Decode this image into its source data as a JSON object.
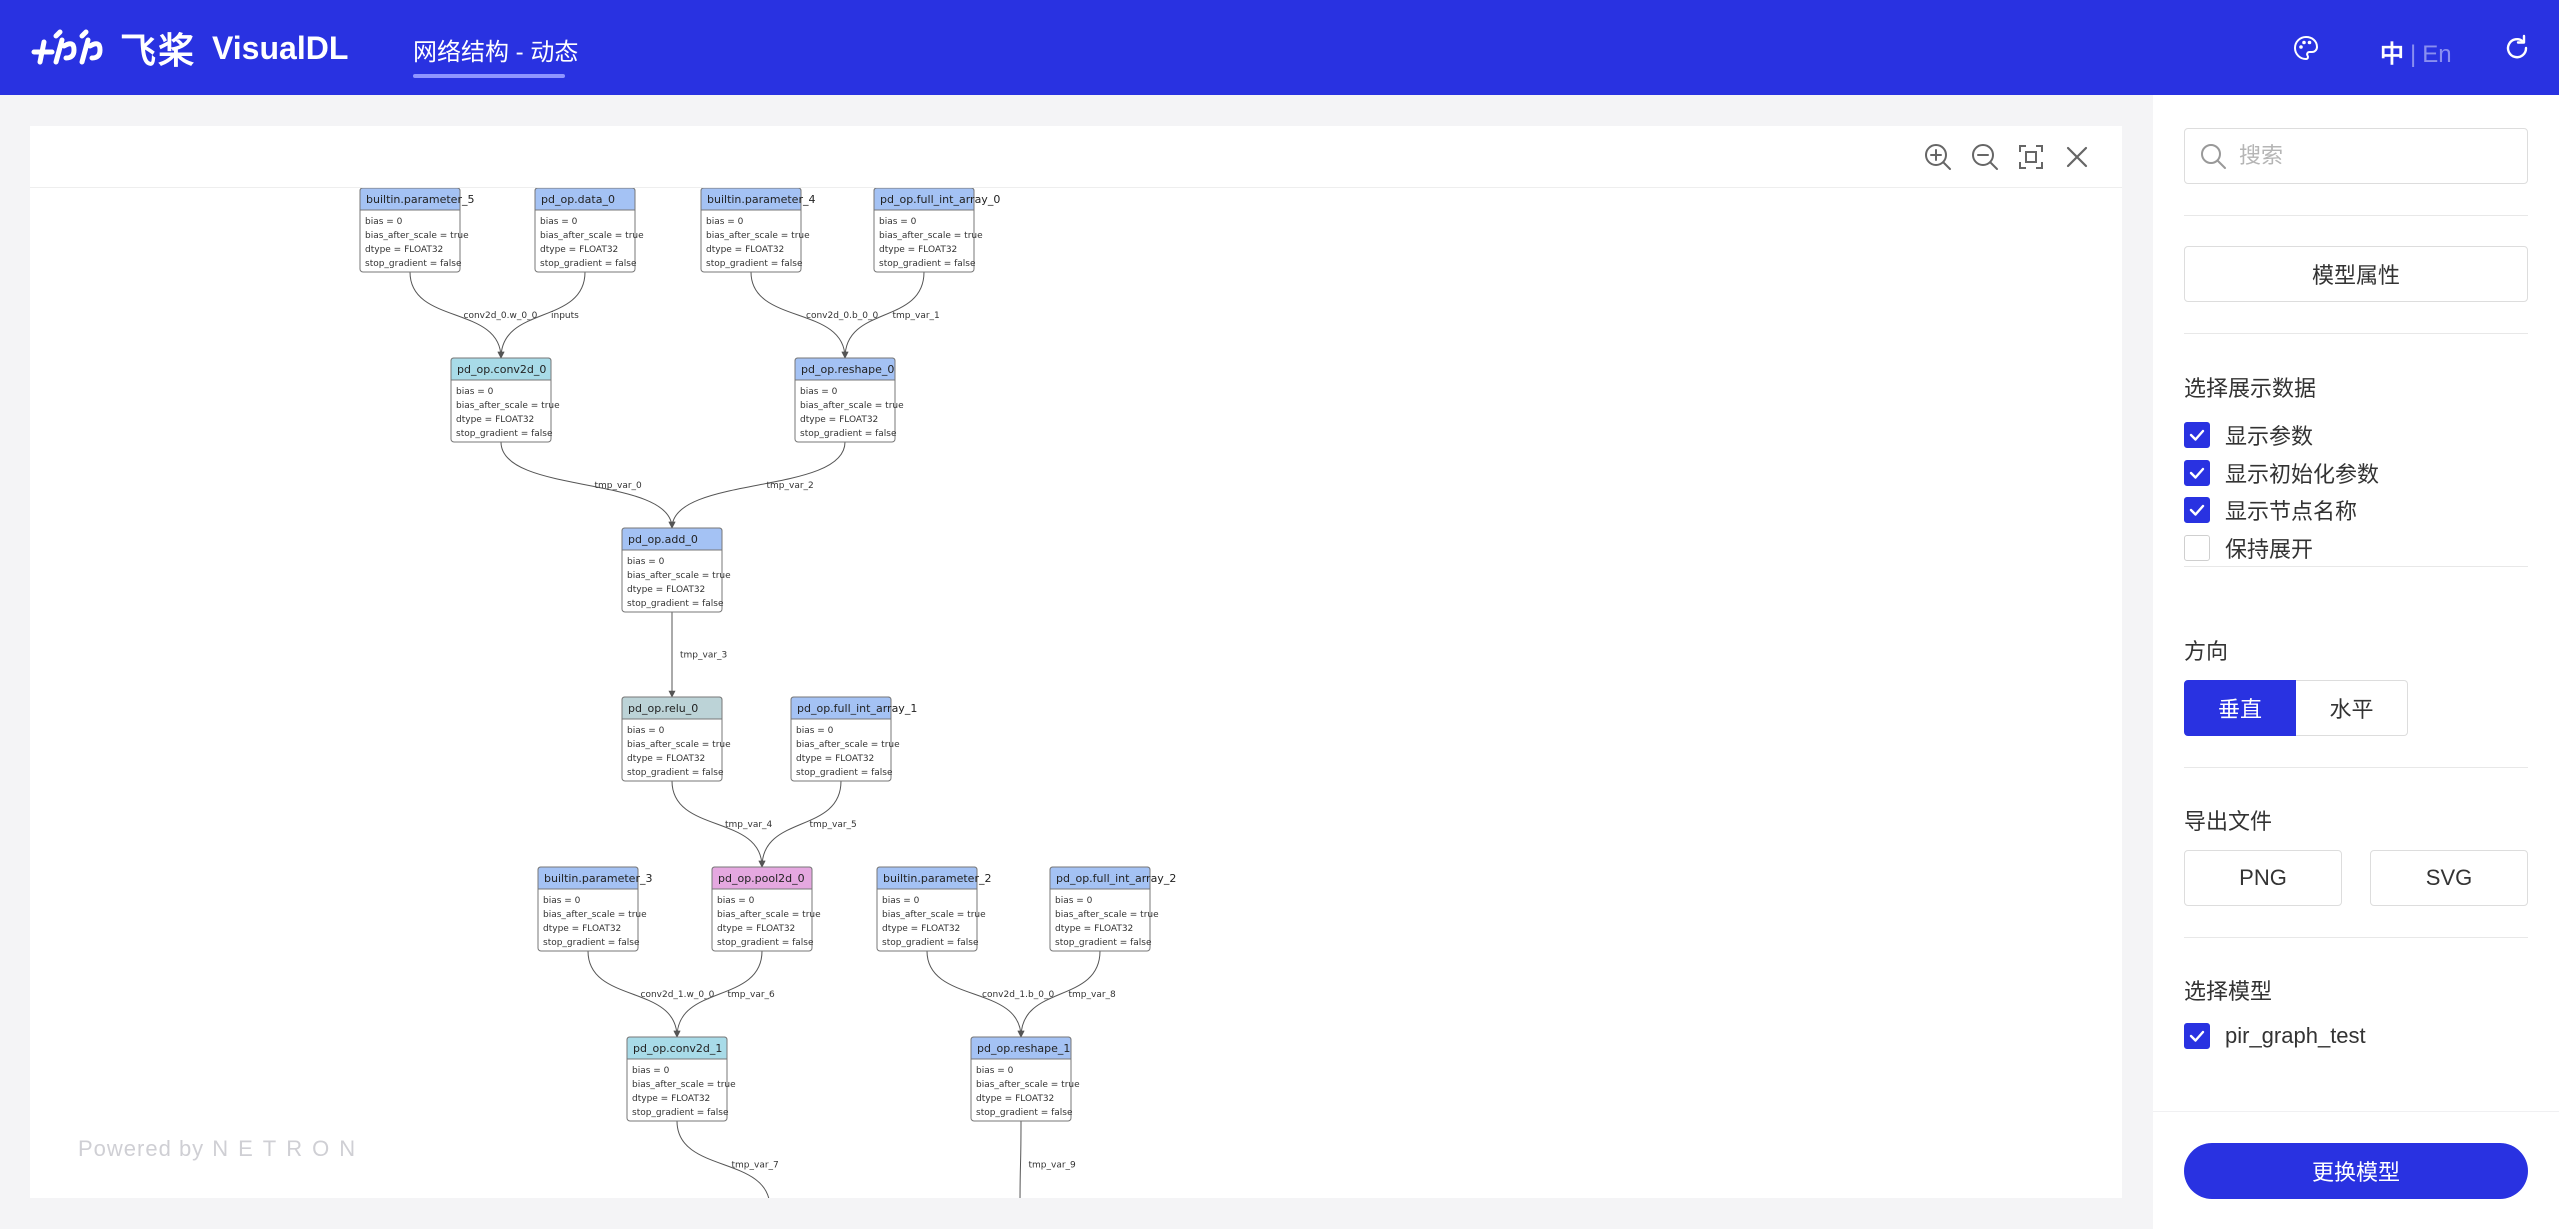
{
  "header": {
    "logo_cn": "飞桨",
    "logo_en": "VisualDL",
    "nav_tab": "网络结构 - 动态",
    "lang_current": "中",
    "lang_separator": "|",
    "lang_other": "En",
    "icons": [
      "palette-icon",
      "refresh-icon"
    ]
  },
  "graph": {
    "toolbar_icons": [
      "zoom-in-icon",
      "zoom-out-icon",
      "fit-screen-icon",
      "close-icon"
    ],
    "powered_by": "Powered by",
    "netron": "NETRON",
    "attr_lines": [
      "bias = 0",
      "bias_after_scale = true",
      "dtype = FLOAT32",
      "stop_gradient = false"
    ],
    "nodes": [
      {
        "id": "n1",
        "title": "builtin.parameter_5",
        "kind": "param"
      },
      {
        "id": "n2",
        "title": "pd_op.data_0",
        "kind": "param"
      },
      {
        "id": "n3",
        "title": "builtin.parameter_4",
        "kind": "param"
      },
      {
        "id": "n4",
        "title": "pd_op.full_int_array_0",
        "kind": "param"
      },
      {
        "id": "n5",
        "title": "pd_op.conv2d_0",
        "kind": "conv"
      },
      {
        "id": "n6",
        "title": "pd_op.reshape_0",
        "kind": "param"
      },
      {
        "id": "n7",
        "title": "pd_op.add_0",
        "kind": "param"
      },
      {
        "id": "n8",
        "title": "pd_op.relu_0",
        "kind": "relu"
      },
      {
        "id": "n9",
        "title": "pd_op.full_int_array_1",
        "kind": "param"
      },
      {
        "id": "n10",
        "title": "builtin.parameter_3",
        "kind": "param"
      },
      {
        "id": "n11",
        "title": "pd_op.pool2d_0",
        "kind": "pool"
      },
      {
        "id": "n12",
        "title": "builtin.parameter_2",
        "kind": "param"
      },
      {
        "id": "n13",
        "title": "pd_op.full_int_array_2",
        "kind": "param"
      },
      {
        "id": "n14",
        "title": "pd_op.conv2d_1",
        "kind": "conv"
      },
      {
        "id": "n15",
        "title": "pd_op.reshape_1",
        "kind": "param"
      }
    ],
    "edges": [
      {
        "from": "n1",
        "to": "n5",
        "label": "conv2d_0.w_0_0"
      },
      {
        "from": "n2",
        "to": "n5",
        "label": "inputs"
      },
      {
        "from": "n3",
        "to": "n6",
        "label": "conv2d_0.b_0_0"
      },
      {
        "from": "n4",
        "to": "n6",
        "label": "tmp_var_1"
      },
      {
        "from": "n5",
        "to": "n7",
        "label": "tmp_var_0"
      },
      {
        "from": "n6",
        "to": "n7",
        "label": "tmp_var_2"
      },
      {
        "from": "n7",
        "to": "n8",
        "label": "tmp_var_3"
      },
      {
        "from": "n8",
        "to": "n11",
        "label": "tmp_var_4"
      },
      {
        "from": "n9",
        "to": "n11",
        "label": "tmp_var_5"
      },
      {
        "from": "n10",
        "to": "n14",
        "label": "conv2d_1.w_0_0"
      },
      {
        "from": "n11",
        "to": "n14",
        "label": "tmp_var_6"
      },
      {
        "from": "n12",
        "to": "n15",
        "label": "conv2d_1.b_0_0"
      },
      {
        "from": "n13",
        "to": "n15",
        "label": "tmp_var_8"
      },
      {
        "from": "n14",
        "to": "out1",
        "label": "tmp_var_7"
      },
      {
        "from": "n15",
        "to": "out2",
        "label": "tmp_var_9"
      }
    ]
  },
  "sidebar": {
    "search_placeholder": "搜索",
    "model_props": "模型属性",
    "display_title": "选择展示数据",
    "display_options": [
      {
        "label": "显示参数",
        "checked": true
      },
      {
        "label": "显示初始化参数",
        "checked": true
      },
      {
        "label": "显示节点名称",
        "checked": true
      },
      {
        "label": "保持展开",
        "checked": false
      }
    ],
    "direction_title": "方向",
    "direction_vertical": "垂直",
    "direction_horizontal": "水平",
    "export_title": "导出文件",
    "export_png": "PNG",
    "export_svg": "SVG",
    "model_title": "选择模型",
    "models": [
      {
        "label": "pir_graph_test",
        "checked": true
      }
    ],
    "change_model": "更换模型"
  },
  "colors": {
    "brand": "#2932e1",
    "node_param": "#a4c2f4",
    "node_conv": "#a8dbe8",
    "node_relu": "#bcd3d7",
    "node_pool": "#e5a8e0"
  }
}
